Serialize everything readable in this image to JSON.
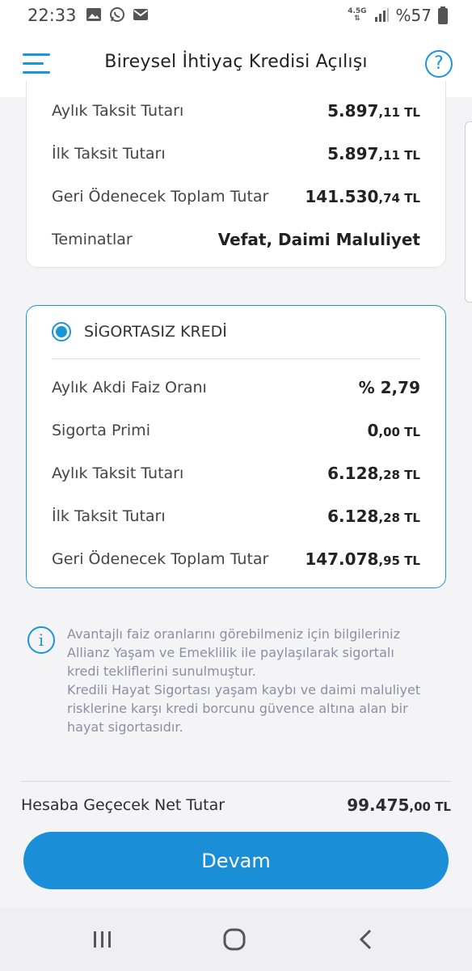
{
  "status_bar": {
    "time": "22:33",
    "network": "4.5G",
    "battery": "%57",
    "icons": [
      "gallery-icon",
      "whatsapp-icon",
      "mail-icon",
      "data-arrows-icon",
      "signal-icon",
      "battery-icon"
    ]
  },
  "app_bar": {
    "title": "Bireysel İhtiyaç Kredisi Açılışı",
    "help": "?"
  },
  "insured_card": {
    "rows": [
      {
        "label": "Aylık Taksit Tutarı",
        "value": "5.897",
        "decimals": ",11 TL"
      },
      {
        "label": "İlk Taksit Tutarı",
        "value": "5.897",
        "decimals": ",11 TL"
      },
      {
        "label": "Geri Ödenecek Toplam Tutar",
        "value": "141.530",
        "decimals": ",74 TL"
      },
      {
        "label": "Teminatlar",
        "value": "Vefat, Daimi Maluliyet",
        "decimals": ""
      }
    ]
  },
  "uninsured_card": {
    "option_label": "SİGORTASIZ KREDİ",
    "selected": true,
    "rows": [
      {
        "label": "Aylık Akdi Faiz Oranı",
        "value": "% 2,79",
        "decimals": ""
      },
      {
        "label": "Sigorta Primi",
        "value": "0",
        "decimals": ",00 TL"
      },
      {
        "label": "Aylık Taksit Tutarı",
        "value": "6.128",
        "decimals": ",28 TL"
      },
      {
        "label": "İlk Taksit Tutarı",
        "value": "6.128",
        "decimals": ",28 TL"
      },
      {
        "label": "Geri Ödenecek Toplam Tutar",
        "value": "147.078",
        "decimals": ",95 TL"
      }
    ]
  },
  "info": {
    "icon": "i",
    "line1": "Avantajlı faiz oranlarını görebilmeniz için bilgileriniz",
    "line2": "Allianz Yaşam ve Emeklilik ile paylaşılarak sigortalı",
    "line3": "kredi tekliflerini sunulmuştur.",
    "line4": "Kredili Hayat Sigortası yaşam kaybı ve daimi maluliyet",
    "line5": "risklerine karşı kredi borcunu güvence altına alan bir",
    "line6": "hayat sigortasıdır."
  },
  "footer": {
    "net_label": "Hesaba Geçecek Net Tutar",
    "net_value": "99.475",
    "net_decimals": ",00 TL",
    "continue_button": "Devam"
  },
  "colors": {
    "accent": "#1a95d8",
    "button": "#1a8fd8",
    "info_text": "#8a8fa3"
  }
}
